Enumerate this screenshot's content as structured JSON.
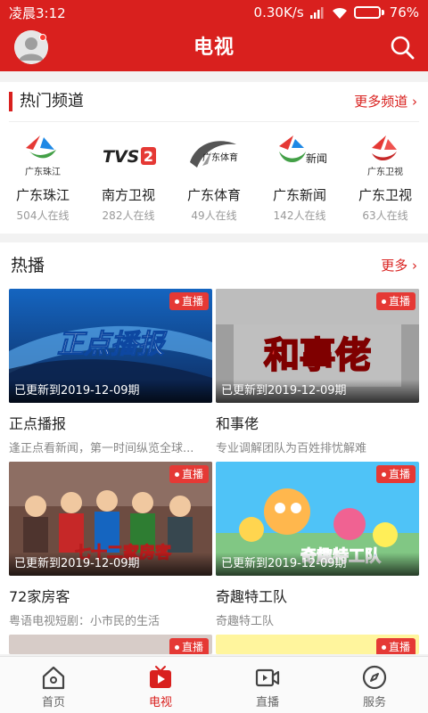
{
  "status_bar": {
    "time": "凌晨3:12",
    "speed": "0.30K/s",
    "battery": "76%",
    "battery_level": 0.76
  },
  "header": {
    "title": "电视"
  },
  "hot_channels": {
    "title": "热门频道",
    "more": "更多频道",
    "more_arrow": "›",
    "items": [
      {
        "name": "广东珠江",
        "viewers": "504人在线",
        "logo_text": "广东珠江"
      },
      {
        "name": "南方卫视",
        "viewers": "282人在线",
        "logo_text": "TVS2"
      },
      {
        "name": "广东体育",
        "viewers": "49人在线",
        "logo_text": "广东体育"
      },
      {
        "name": "广东新闻",
        "viewers": "142人在线",
        "logo_text": "新闻"
      },
      {
        "name": "广东卫视",
        "viewers": "63人在线",
        "logo_text": "广东卫视"
      }
    ]
  },
  "hot_play": {
    "title": "热播",
    "more": "更多",
    "more_arrow": "›",
    "badge": "直播",
    "items": [
      {
        "title": "正点播报",
        "desc": "逢正点看新闻，第一时间纵览全球...",
        "caption": "已更新到2019-12-09期",
        "art_text": "正点播报"
      },
      {
        "title": "和事佬",
        "desc": "专业调解团队为百姓排忧解难",
        "caption": "已更新到2019-12-09期",
        "art_text": "和事佬"
      },
      {
        "title": "72家房客",
        "desc": "粤语电视短剧：小市民的生活",
        "caption": "已更新到2019-12-09期",
        "art_text": "七十二家房客"
      },
      {
        "title": "奇趣特工队",
        "desc": "奇趣特工队",
        "caption": "已更新到2019-12-09期",
        "art_text": "奇趣特工队"
      }
    ]
  },
  "bottom_nav": [
    {
      "label": "首页",
      "icon": "home-icon"
    },
    {
      "label": "电视",
      "icon": "tv-icon",
      "active": true
    },
    {
      "label": "直播",
      "icon": "live-camera-icon"
    },
    {
      "label": "服务",
      "icon": "compass-icon"
    }
  ],
  "colors": {
    "brand": "#d9201e",
    "badge": "#e53935"
  }
}
